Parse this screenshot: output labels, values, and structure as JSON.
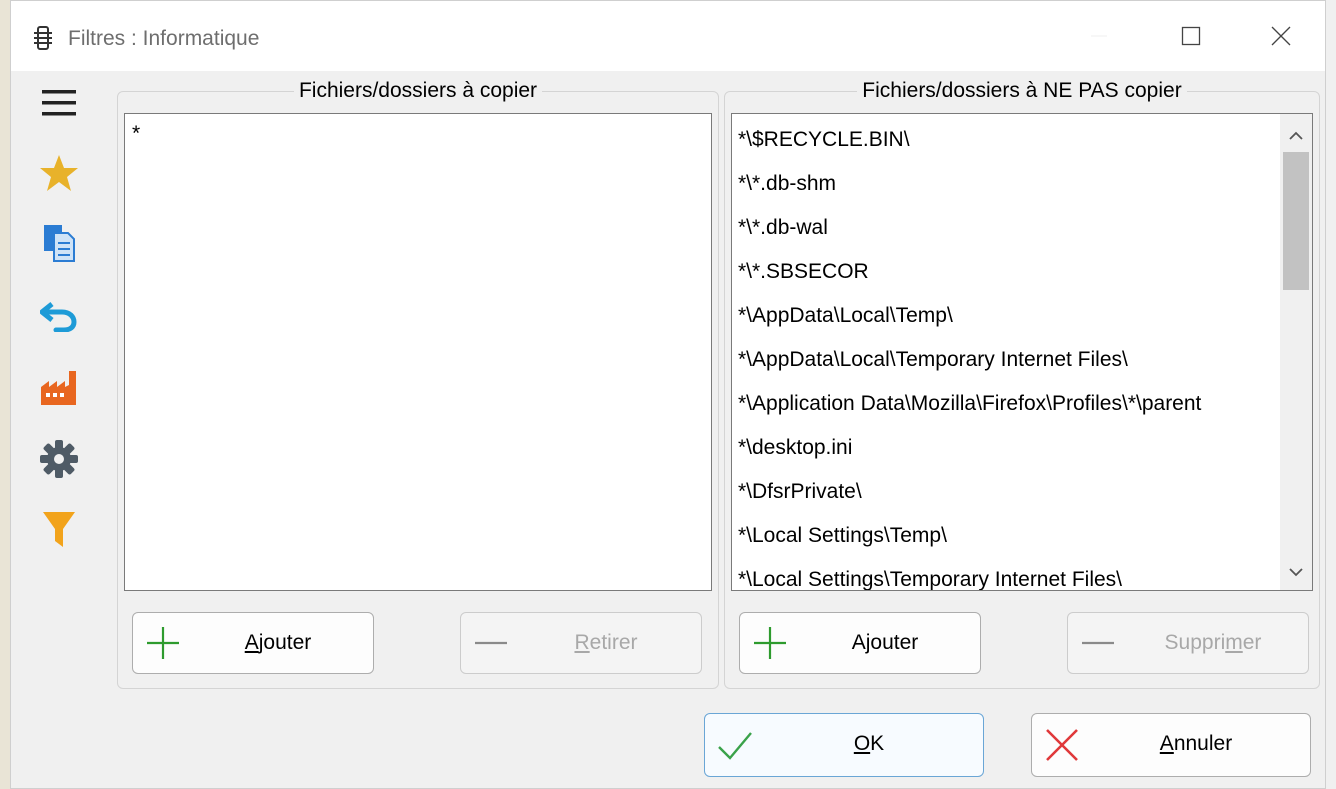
{
  "window": {
    "title": "Filtres : Informatique"
  },
  "sidebar": {
    "icons": [
      "menu-icon",
      "star-icon",
      "copy-icon",
      "undo-icon",
      "factory-icon",
      "gear-icon",
      "filter-icon"
    ]
  },
  "include_group": {
    "legend": "Fichiers/dossiers à copier",
    "items": [
      "*"
    ],
    "add_button": {
      "prefix": "",
      "accel": "A",
      "rest": "jouter"
    },
    "remove_button": {
      "prefix": "",
      "accel": "R",
      "rest": "etirer"
    }
  },
  "exclude_group": {
    "legend": "Fichiers/dossiers à NE PAS copier",
    "items": [
      "*\\$RECYCLE.BIN\\",
      "*\\*.db-shm",
      "*\\*.db-wal",
      "*\\*.SBSECOR",
      "*\\AppData\\Local\\Temp\\",
      "*\\AppData\\Local\\Temporary Internet Files\\",
      "*\\Application Data\\Mozilla\\Firefox\\Profiles\\*\\parent",
      "*\\desktop.ini",
      "*\\DfsrPrivate\\",
      "*\\Local Settings\\Temp\\",
      "*\\Local Settings\\Temporary Internet Files\\"
    ],
    "add_button": {
      "prefix": "A",
      "accel": "j",
      "rest": "outer"
    },
    "remove_button": {
      "prefix": "Suppri",
      "accel": "m",
      "rest": "er"
    }
  },
  "footer": {
    "ok_button": {
      "prefix": "",
      "accel": "O",
      "rest": "K"
    },
    "cancel_button": {
      "prefix": "",
      "accel": "A",
      "rest": "nnuler"
    }
  },
  "colors": {
    "star": "#e8b22a",
    "factory": "#e8661f",
    "filter": "#f2a31b",
    "undo": "#1e9bd7",
    "copy": "#2b7cd3",
    "gear": "#4f5b66",
    "plus": "#2e9b2e",
    "ok_check": "#3aa24a",
    "cancel_x": "#e0383a"
  }
}
